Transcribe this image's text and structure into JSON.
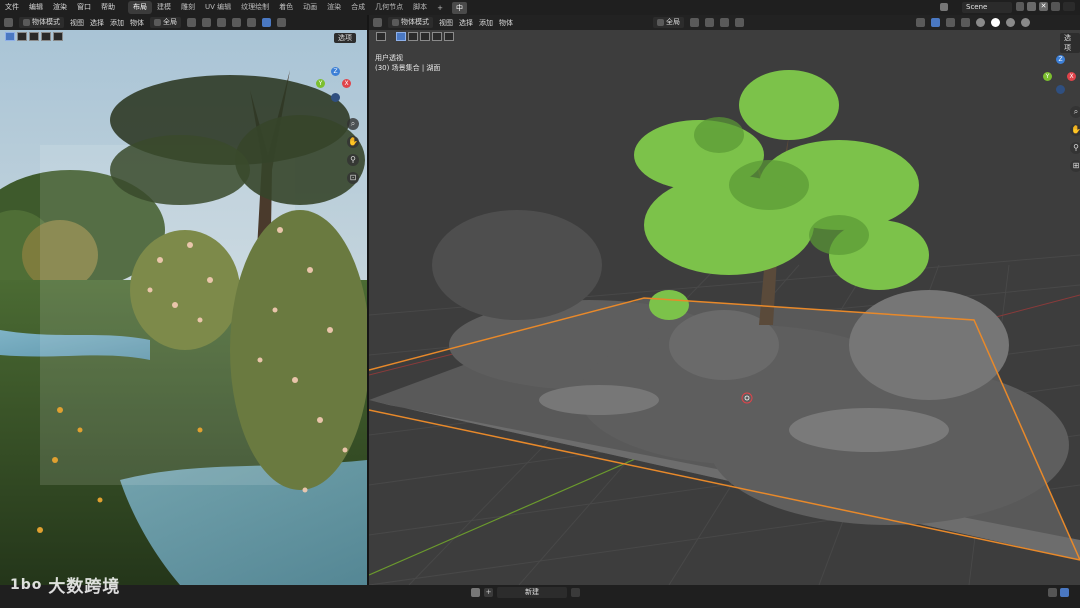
{
  "menu": {
    "items": [
      "文件",
      "编辑",
      "渲染",
      "窗口",
      "帮助"
    ]
  },
  "workspaces": {
    "tabs": [
      "布局",
      "建模",
      "雕刻",
      "UV 编辑",
      "纹理绘制",
      "着色",
      "动画",
      "渲染",
      "合成",
      "几何节点",
      "脚本"
    ],
    "active_index": 0,
    "add_label": "+",
    "lang_badge": "中"
  },
  "scene": {
    "name": "Scene"
  },
  "left_viewport": {
    "mode_label": "物体模式",
    "menus": [
      "视图",
      "选择",
      "添加",
      "物体"
    ],
    "transform_label": "全局",
    "options_label": "选项"
  },
  "right_viewport": {
    "mode_label": "物体模式",
    "menus": [
      "视图",
      "选择",
      "添加",
      "物体"
    ],
    "transform_label": "全局",
    "options_label": "选项",
    "view_name": "用户透视",
    "collection_info": "(30) 场景集合 | 湖面"
  },
  "timeline": {
    "new_label": "新建"
  },
  "watermark": {
    "logo": "1bo",
    "text": "大数跨境"
  },
  "colors": {
    "selection_outline": "#e8892a",
    "foliage_green": "#7cc24a",
    "viewport_bg": "#3d3d3d",
    "axis_red": "#e0434a",
    "axis_green": "#7cbf2f",
    "axis_blue": "#3c7fd6"
  }
}
